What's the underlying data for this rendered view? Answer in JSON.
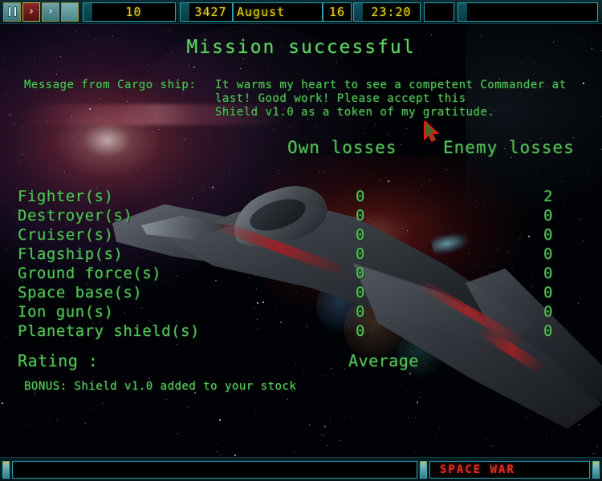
{
  "topbar": {
    "buttons": [
      {
        "name": "pause-button",
        "icon": "pause-icon",
        "label": "",
        "state": "normal"
      },
      {
        "name": "play-button",
        "icon": "chevron-right-icon",
        "label": "›",
        "state": "active"
      },
      {
        "name": "fast-forward-button",
        "icon": "chevron-double-right-icon",
        "label": "›",
        "state": "normal"
      },
      {
        "name": "blank-button",
        "icon": "blank-icon",
        "label": "",
        "state": "normal"
      }
    ],
    "credits": "10",
    "year": "3427",
    "month": "August",
    "day": "16",
    "time": "23:20",
    "blank_field": "",
    "wide_field": ""
  },
  "screen": {
    "title": "Mission successful",
    "message_label": "Message from Cargo ship:",
    "message_body": "It warms my heart to see a competent Commander at\nlast! Good work! Please accept this\nShield v1.0 as a token of my gratitude."
  },
  "losses_table": {
    "col_own": "Own losses",
    "col_enemy": "Enemy losses",
    "rows": [
      {
        "label": "Fighter(s)",
        "own": "0",
        "enemy": "2"
      },
      {
        "label": "Destroyer(s)",
        "own": "0",
        "enemy": "0"
      },
      {
        "label": "Cruiser(s)",
        "own": "0",
        "enemy": "0"
      },
      {
        "label": "Flagship(s)",
        "own": "0",
        "enemy": "0"
      },
      {
        "label": "Ground force(s)",
        "own": "0",
        "enemy": "0"
      },
      {
        "label": "Space base(s)",
        "own": "0",
        "enemy": "0"
      },
      {
        "label": "Ion gun(s)",
        "own": "0",
        "enemy": "0"
      },
      {
        "label": "Planetary shield(s)",
        "own": "0",
        "enemy": "0"
      }
    ]
  },
  "rating": {
    "label": "Rating :",
    "value": "Average"
  },
  "bonus": {
    "text": "BONUS: Shield v1.0 added to your stock"
  },
  "bottombar": {
    "message": "",
    "game_title": "SPACE WAR"
  },
  "colors": {
    "green_text": "#55c05a",
    "yellow_readout": "#e9d21c",
    "teal_chrome": "#2aa0ad",
    "red_title": "#e22b22",
    "red_button": "#8d2422"
  }
}
